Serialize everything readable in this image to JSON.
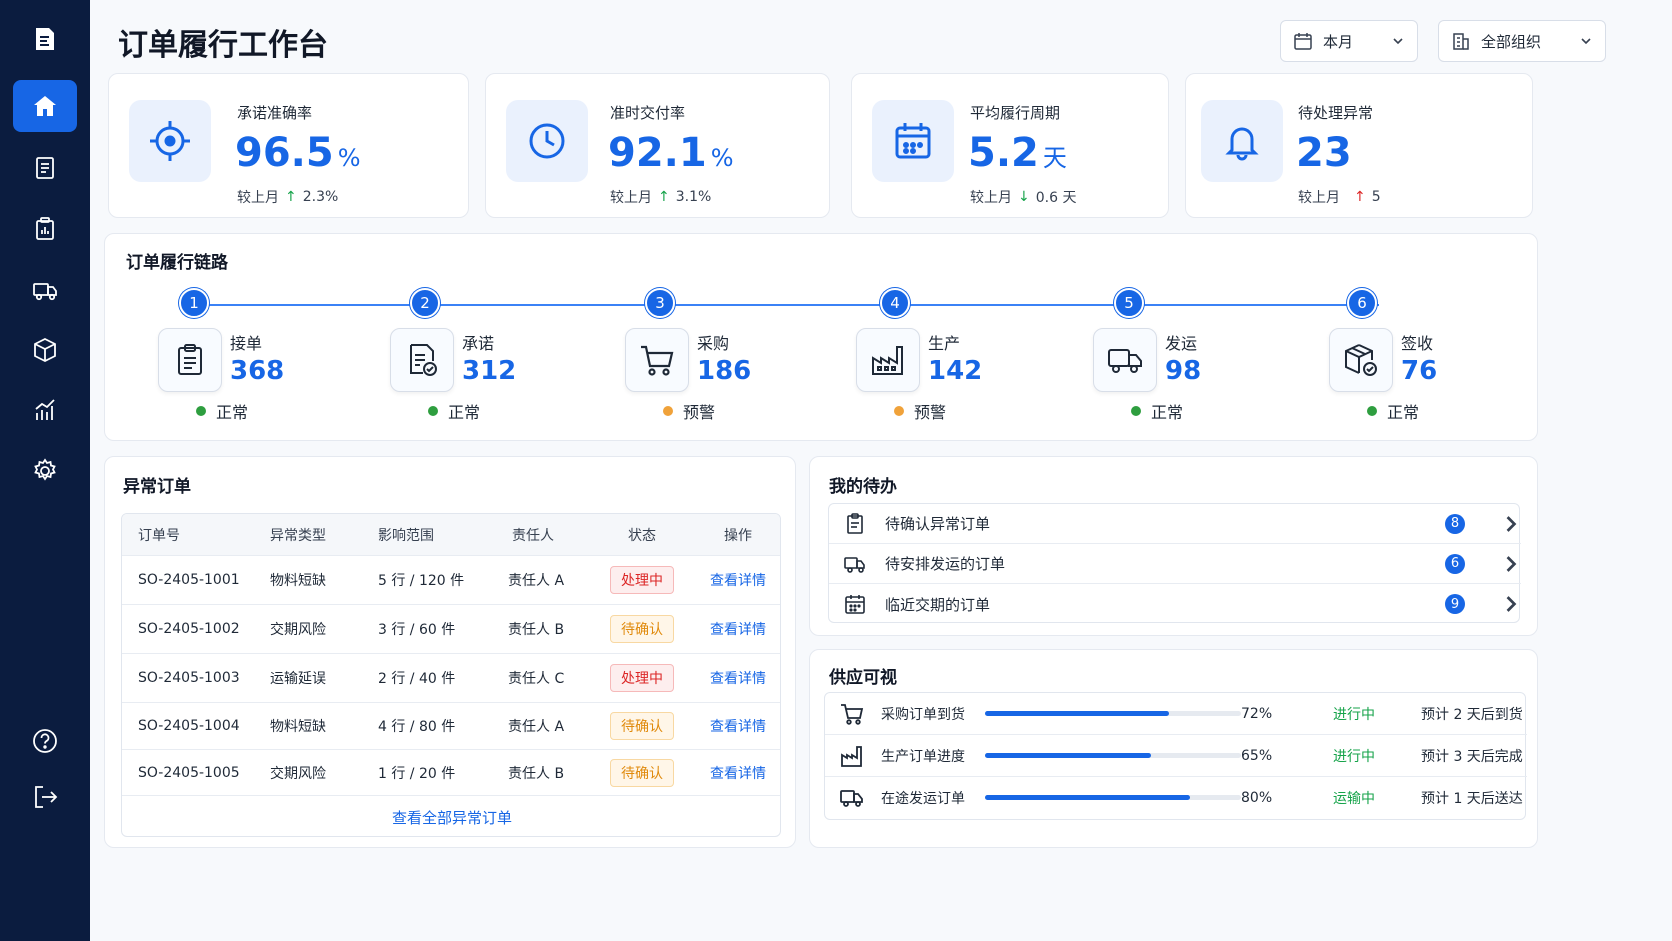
{
  "sidebar": {
    "icons": [
      "logo-doc-icon",
      "home-icon",
      "document-icon",
      "clipboard-chart-icon",
      "truck-icon",
      "box-icon",
      "analytics-icon",
      "settings-icon",
      "help-icon",
      "logout-icon"
    ]
  },
  "header": {
    "title": "订单履行工作台",
    "period_select": "本月",
    "org_select": "全部组织"
  },
  "kpis": [
    {
      "label": "承诺准确率",
      "value": "96.5",
      "unit": "%",
      "compare_label": "较上月",
      "direction": "up",
      "delta": "2.3%",
      "icon": "target-icon"
    },
    {
      "label": "准时交付率",
      "value": "92.1",
      "unit": "%",
      "compare_label": "较上月",
      "direction": "up",
      "delta": "3.1%",
      "icon": "clock-icon"
    },
    {
      "label": "平均履行周期",
      "value": "5.2",
      "unit": "天",
      "compare_label": "较上月",
      "direction": "down",
      "delta": "0.6 天",
      "icon": "calendar-icon"
    },
    {
      "label": "待处理异常",
      "value": "23",
      "unit": "",
      "compare_label": "较上月",
      "direction": "up",
      "delta": "5",
      "icon": "bell-icon"
    }
  ],
  "chain": {
    "title": "订单履行链路",
    "steps": [
      {
        "num": "1",
        "name": "接单",
        "count": "368",
        "status": "正常",
        "status_color": "#2e9e3f",
        "icon": "clipboard-icon"
      },
      {
        "num": "2",
        "name": "承诺",
        "count": "312",
        "status": "正常",
        "status_color": "#2e9e3f",
        "icon": "document-check-icon"
      },
      {
        "num": "3",
        "name": "采购",
        "count": "186",
        "status": "预警",
        "status_color": "#f0a23a",
        "icon": "cart-icon"
      },
      {
        "num": "4",
        "name": "生产",
        "count": "142",
        "status": "预警",
        "status_color": "#f0a23a",
        "icon": "factory-icon"
      },
      {
        "num": "5",
        "name": "发运",
        "count": "98",
        "status": "正常",
        "status_color": "#2e9e3f",
        "icon": "truck-icon"
      },
      {
        "num": "6",
        "name": "签收",
        "count": "76",
        "status": "正常",
        "status_color": "#2e9e3f",
        "icon": "package-check-icon"
      }
    ]
  },
  "exceptions": {
    "title": "异常订单",
    "columns": [
      "订单号",
      "异常类型",
      "影响范围",
      "责任人",
      "状态",
      "操作"
    ],
    "rows": [
      {
        "id": "SO-2405-1001",
        "type": "物料短缺",
        "scope": "5 行 / 120 件",
        "owner": "责任人 A",
        "status": "处理中",
        "status_style": "red",
        "action": "查看详情"
      },
      {
        "id": "SO-2405-1002",
        "type": "交期风险",
        "scope": "3 行 / 60 件",
        "owner": "责任人 B",
        "status": "待确认",
        "status_style": "orange",
        "action": "查看详情"
      },
      {
        "id": "SO-2405-1003",
        "type": "运输延误",
        "scope": "2 行 / 40 件",
        "owner": "责任人 C",
        "status": "处理中",
        "status_style": "red",
        "action": "查看详情"
      },
      {
        "id": "SO-2405-1004",
        "type": "物料短缺",
        "scope": "4 行 / 80 件",
        "owner": "责任人 A",
        "status": "待确认",
        "status_style": "orange",
        "action": "查看详情"
      },
      {
        "id": "SO-2405-1005",
        "type": "交期风险",
        "scope": "1 行 / 20 件",
        "owner": "责任人 B",
        "status": "待确认",
        "status_style": "orange",
        "action": "查看详情"
      }
    ],
    "view_all": "查看全部异常订单"
  },
  "todos": {
    "title": "我的待办",
    "items": [
      {
        "label": "待确认异常订单",
        "count": "8",
        "icon": "clipboard-icon"
      },
      {
        "label": "待安排发运的订单",
        "count": "6",
        "icon": "truck-icon"
      },
      {
        "label": "临近交期的订单",
        "count": "9",
        "icon": "calendar-icon"
      }
    ]
  },
  "supply": {
    "title": "供应可视",
    "items": [
      {
        "label": "采购订单到货",
        "progress": 72,
        "percent": "72%",
        "status": "进行中",
        "eta": "预计 2 天后到货",
        "icon": "cart-icon"
      },
      {
        "label": "生产订单进度",
        "progress": 65,
        "percent": "65%",
        "status": "进行中",
        "eta": "预计 3 天后完成",
        "icon": "factory-icon"
      },
      {
        "label": "在途发运订单",
        "progress": 80,
        "percent": "80%",
        "status": "运输中",
        "eta": "预计 1 天后送达",
        "icon": "truck-icon"
      }
    ]
  },
  "colors": {
    "accent": "#1766e5",
    "sidebar": "#0b1c3f",
    "ok": "#2e9e3f",
    "warn": "#f0a23a"
  }
}
